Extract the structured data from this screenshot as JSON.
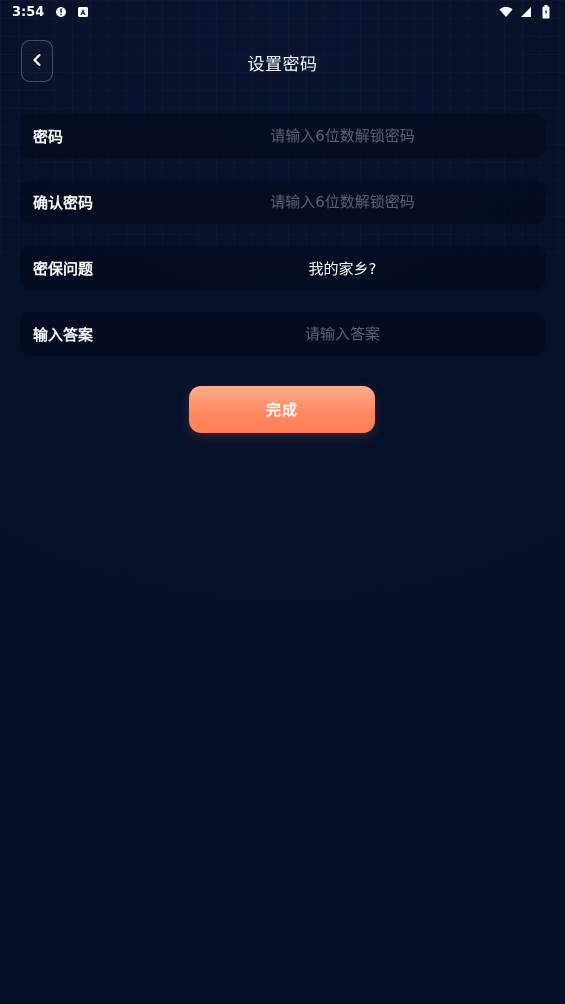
{
  "status_bar": {
    "time": "3:54"
  },
  "header": {
    "title": "设置密码"
  },
  "form": {
    "password": {
      "label": "密码",
      "placeholder": "请输入6位数解锁密码"
    },
    "confirm_password": {
      "label": "确认密码",
      "placeholder": "请输入6位数解锁密码"
    },
    "security_question": {
      "label": "密保问题",
      "value": "我的家乡?"
    },
    "answer": {
      "label": "输入答案",
      "placeholder": "请输入答案"
    }
  },
  "actions": {
    "submit_label": "完成"
  },
  "icons": {
    "status_left": [
      "alert-icon",
      "app-a-icon"
    ],
    "status_right": [
      "wifi-icon",
      "signal-icon",
      "battery-icon"
    ],
    "back": "chevron-left-icon"
  },
  "colors": {
    "background": "#06112a",
    "row_background": "#020a19",
    "submit_gradient_start": "#ffad8c",
    "submit_gradient_end": "#ff7d55"
  }
}
